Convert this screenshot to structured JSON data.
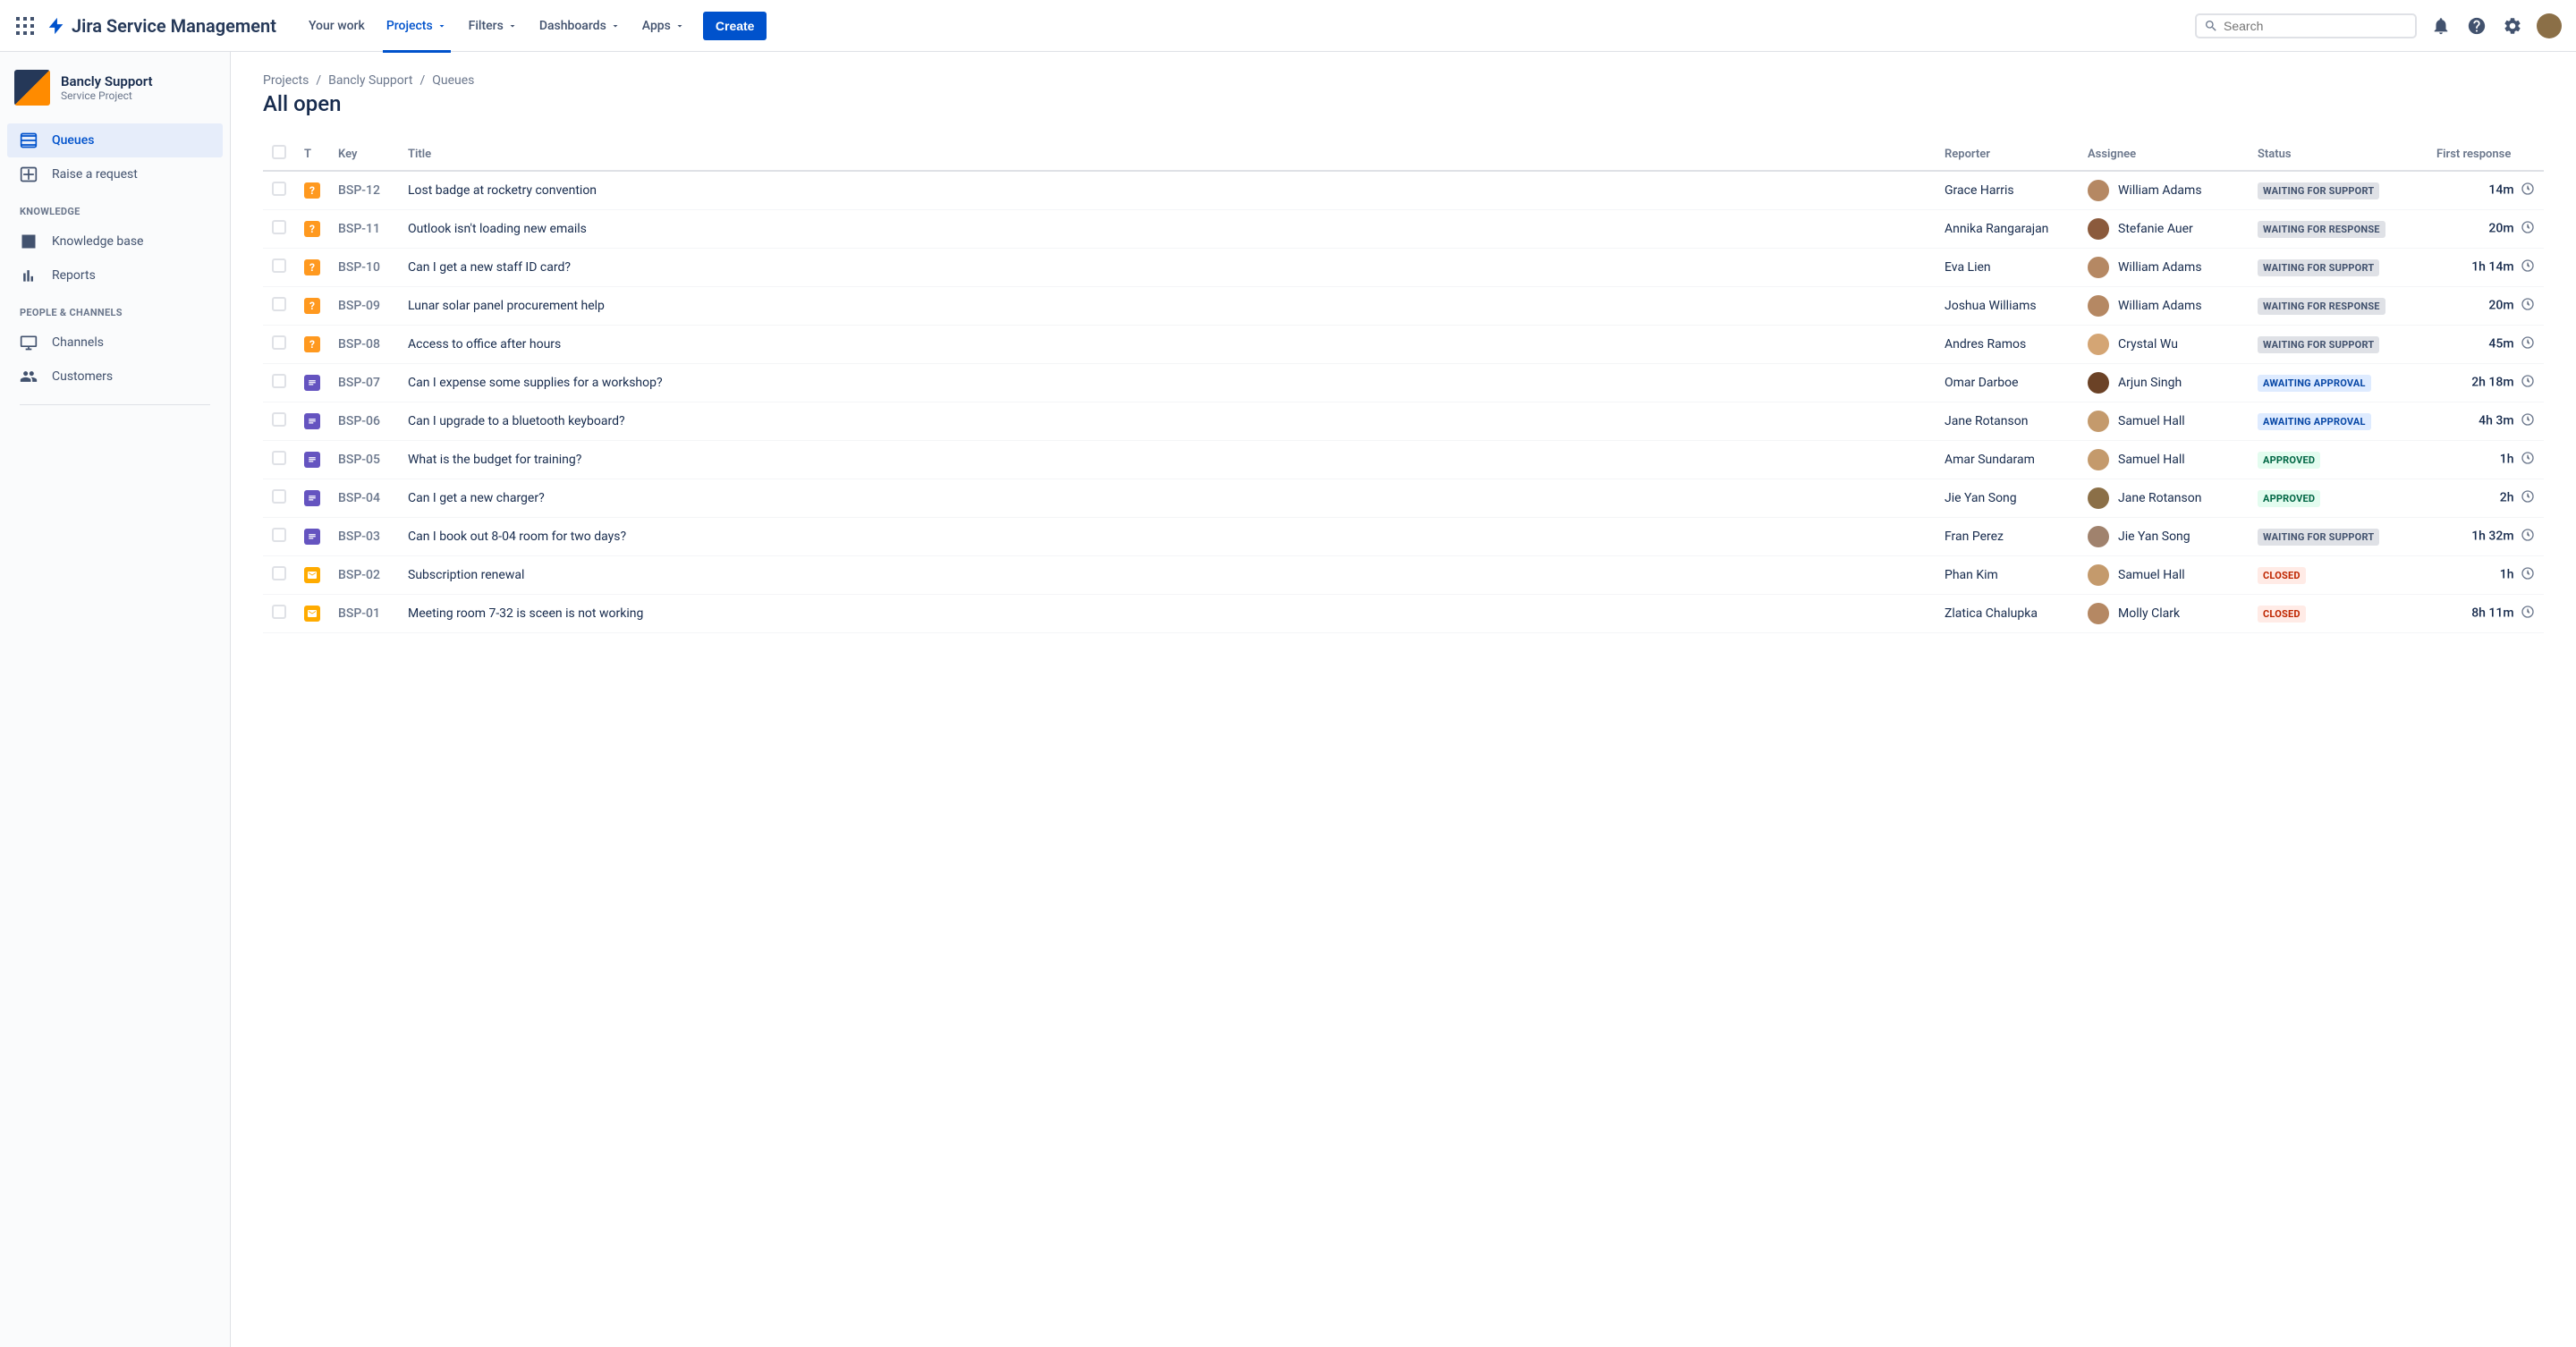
{
  "header": {
    "product": "Jira Service Management",
    "nav": {
      "your_work": "Your work",
      "projects": "Projects",
      "filters": "Filters",
      "dashboards": "Dashboards",
      "apps": "Apps"
    },
    "create": "Create",
    "search_placeholder": "Search"
  },
  "sidebar": {
    "project_name": "Bancly Support",
    "project_type": "Service Project",
    "items": {
      "queues": "Queues",
      "raise": "Raise a request"
    },
    "section_knowledge": "KNOWLEDGE",
    "knowledge_items": {
      "kb": "Knowledge base",
      "reports": "Reports"
    },
    "section_people": "PEOPLE & CHANNELS",
    "people_items": {
      "channels": "Channels",
      "customers": "Customers"
    }
  },
  "breadcrumb": {
    "projects": "Projects",
    "project": "Bancly Support",
    "current": "Queues"
  },
  "page_title": "All open",
  "columns": {
    "t": "T",
    "key": "Key",
    "title": "Title",
    "reporter": "Reporter",
    "assignee": "Assignee",
    "status": "Status",
    "first_response": "First response"
  },
  "statuses": {
    "waiting_support": "WAITING FOR SUPPORT",
    "waiting_response": "WAITING FOR RESPONSE",
    "awaiting_approval": "AWAITING APPROVAL",
    "approved": "APPROVED",
    "closed": "CLOSED"
  },
  "rows": [
    {
      "type": "question",
      "key": "BSP-12",
      "title": "Lost badge at rocketry convention",
      "reporter": "Grace Harris",
      "assignee": "William Adams",
      "avatar": "#b58863",
      "status": "waiting_support",
      "status_class": "gray",
      "time": "14m"
    },
    {
      "type": "question",
      "key": "BSP-11",
      "title": "Outlook isn't loading new emails",
      "reporter": "Annika Rangarajan",
      "assignee": "Stefanie Auer",
      "avatar": "#8b5a3c",
      "status": "waiting_response",
      "status_class": "gray",
      "time": "20m"
    },
    {
      "type": "question",
      "key": "BSP-10",
      "title": "Can I get a new staff ID card?",
      "reporter": "Eva Lien",
      "assignee": "William Adams",
      "avatar": "#b58863",
      "status": "waiting_support",
      "status_class": "gray",
      "time": "1h 14m"
    },
    {
      "type": "question",
      "key": "BSP-09",
      "title": "Lunar solar panel procurement help",
      "reporter": "Joshua Williams",
      "assignee": "William Adams",
      "avatar": "#b58863",
      "status": "waiting_response",
      "status_class": "gray",
      "time": "20m"
    },
    {
      "type": "question",
      "key": "BSP-08",
      "title": "Access to office after hours",
      "reporter": "Andres Ramos",
      "assignee": "Crystal Wu",
      "avatar": "#d4a574",
      "status": "waiting_support",
      "status_class": "gray",
      "time": "45m"
    },
    {
      "type": "task",
      "key": "BSP-07",
      "title": "Can I expense some supplies for a workshop?",
      "reporter": "Omar Darboe",
      "assignee": "Arjun Singh",
      "avatar": "#6b4226",
      "status": "awaiting_approval",
      "status_class": "blue",
      "time": "2h 18m"
    },
    {
      "type": "task",
      "key": "BSP-06",
      "title": "Can I upgrade to a bluetooth keyboard?",
      "reporter": "Jane Rotanson",
      "assignee": "Samuel Hall",
      "avatar": "#c49a6c",
      "status": "awaiting_approval",
      "status_class": "blue",
      "time": "4h 3m"
    },
    {
      "type": "task",
      "key": "BSP-05",
      "title": "What is the budget for training?",
      "reporter": "Amar Sundaram",
      "assignee": "Samuel Hall",
      "avatar": "#c49a6c",
      "status": "approved",
      "status_class": "green",
      "time": "1h"
    },
    {
      "type": "task",
      "key": "BSP-04",
      "title": "Can I get a new charger?",
      "reporter": "Jie Yan Song",
      "assignee": "Jane Rotanson",
      "avatar": "#8b6f47",
      "status": "approved",
      "status_class": "green",
      "time": "2h"
    },
    {
      "type": "task",
      "key": "BSP-03",
      "title": "Can I book out 8-04 room for two days?",
      "reporter": "Fran Perez",
      "assignee": "Jie Yan Song",
      "avatar": "#a0826d",
      "status": "waiting_support",
      "status_class": "gray",
      "time": "1h 32m"
    },
    {
      "type": "email",
      "key": "BSP-02",
      "title": "Subscription renewal",
      "reporter": "Phan Kim",
      "assignee": "Samuel Hall",
      "avatar": "#c49a6c",
      "status": "closed",
      "status_class": "red",
      "time": "1h"
    },
    {
      "type": "email",
      "key": "BSP-01",
      "title": "Meeting room 7-32 is sceen is not working",
      "reporter": "Zlatica Chalupka",
      "assignee": "Molly Clark",
      "avatar": "#b58863",
      "status": "closed",
      "status_class": "red",
      "time": "8h 11m"
    }
  ]
}
